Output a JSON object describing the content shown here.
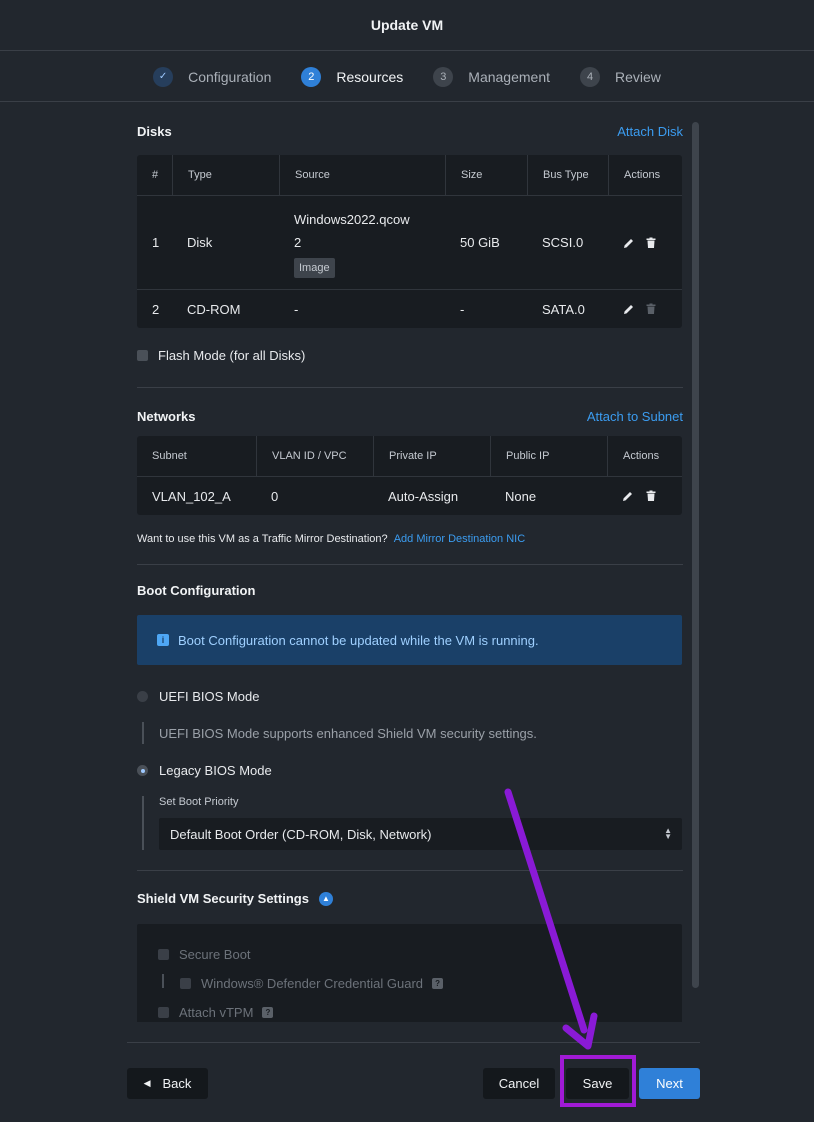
{
  "window": {
    "title": "Update VM"
  },
  "stepper": {
    "steps": [
      {
        "number": "✓",
        "label": "Configuration"
      },
      {
        "number": "2",
        "label": "Resources"
      },
      {
        "number": "3",
        "label": "Management"
      },
      {
        "number": "4",
        "label": "Review"
      }
    ]
  },
  "disks": {
    "title": "Disks",
    "attach_label": "Attach Disk",
    "columns": [
      "#",
      "Type",
      "Source",
      "Size",
      "Bus Type",
      "Actions"
    ],
    "rows": [
      {
        "num": "1",
        "type": "Disk",
        "source_line1": "Windows2022.qcow",
        "source_line2": "2",
        "source_tag": "Image",
        "size": "50 GiB",
        "bus": "SCSI.0"
      },
      {
        "num": "2",
        "type": "CD-ROM",
        "source": "-",
        "size": "-",
        "bus": "SATA.0"
      }
    ],
    "flash_mode_label": "Flash Mode (for all Disks)"
  },
  "networks": {
    "title": "Networks",
    "attach_label": "Attach to Subnet",
    "columns": [
      "Subnet",
      "VLAN ID / VPC",
      "Private IP",
      "Public IP",
      "Actions"
    ],
    "rows": [
      {
        "subnet": "VLAN_102_A",
        "vlan": "0",
        "private_ip": "Auto-Assign",
        "public_ip": "None"
      }
    ],
    "mirror_text": "Want to use this VM as a Traffic Mirror Destination?",
    "mirror_link": "Add Mirror Destination NIC"
  },
  "boot": {
    "title": "Boot Configuration",
    "banner": "Boot Configuration cannot be updated while the VM is running.",
    "uefi_label": "UEFI BIOS Mode",
    "uefi_hint": "UEFI BIOS Mode supports enhanced Shield VM security settings.",
    "legacy_label": "Legacy BIOS Mode",
    "priority_label": "Set Boot Priority",
    "priority_value": "Default Boot Order (CD-ROM, Disk, Network)"
  },
  "shield": {
    "title": "Shield VM Security Settings",
    "secure_boot": "Secure Boot",
    "credential_guard": "Windows® Defender Credential Guard",
    "vtpm": "Attach vTPM",
    "help": "?"
  },
  "footer": {
    "back": "Back",
    "cancel": "Cancel",
    "save": "Save",
    "next": "Next"
  },
  "colors": {
    "accent": "#2f80d8",
    "link": "#3b9cf0",
    "annotation": "#a11ad6"
  }
}
